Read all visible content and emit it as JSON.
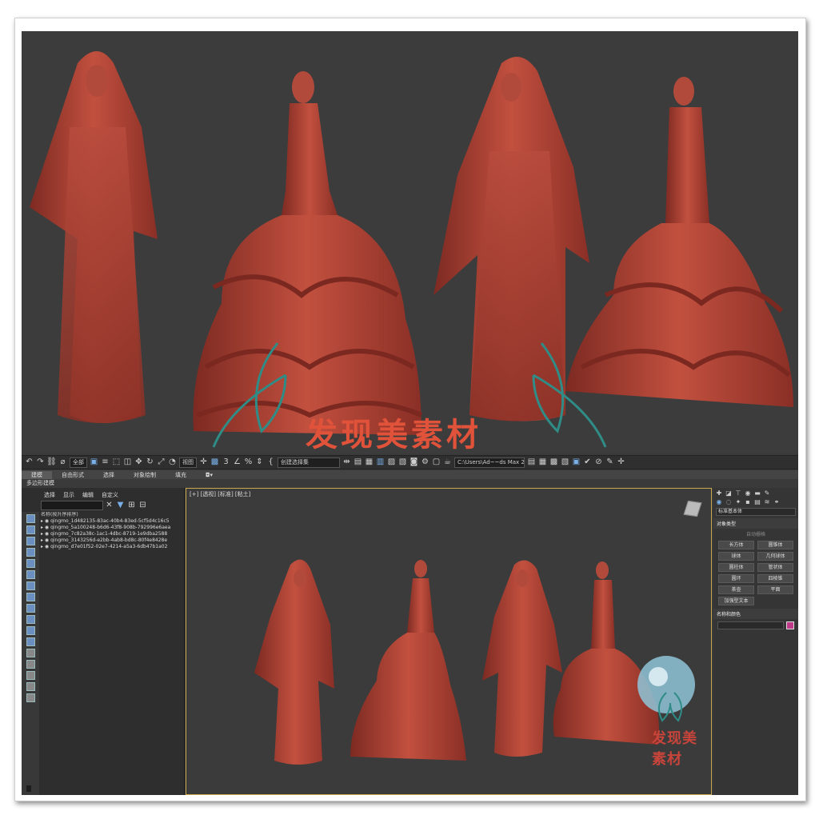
{
  "watermark": {
    "main_text": "发现美素材",
    "small_text": "发现美素材"
  },
  "toolbar": {
    "selection_filter": "全部",
    "view_dropdown": "视图",
    "selection_set": "创建选择集",
    "path_field": "C:\\Users\\Ad~~ds Max 2024"
  },
  "ribbon": {
    "tabs": [
      "建模",
      "自由形式",
      "选择",
      "对象绘制",
      "填充"
    ],
    "sub_label": "多边形建模"
  },
  "explorer": {
    "menu": [
      "选择",
      "显示",
      "编辑",
      "自定义"
    ],
    "header": "名称(按升序排序)",
    "rows": [
      "qingmo_1d482135-83ac-40b4-83ed-5cf5d4c16c5",
      "qingmo_5a100248-b6d6-43f8-908b-792996e6aea",
      "qingmo_7c82a38c-1ac1-4dbc-8719-1e9dba2588",
      "qingmo_3143256d-e2bb-4ab8-bd8c-80f4e8428e",
      "qingmo_d7e01f52-02e7-4214-a5a3-6db47b1a02"
    ]
  },
  "viewport": {
    "label": "[+] [透视] [标准] [粘土]"
  },
  "command_panel": {
    "category": "标准基本体",
    "rollout_object_type": "对象类型",
    "autogrid": "自动栅格",
    "buttons": [
      "长方体",
      "圆锥体",
      "球体",
      "几何球体",
      "圆柱体",
      "管状体",
      "圆环",
      "四棱锥",
      "茶壶",
      "平面",
      "加强型文本"
    ],
    "rollout_name_color": "名称和颜色"
  },
  "colors": {
    "clay": "#b0463c",
    "watermark": "#e0533a",
    "teal_butterfly": "#2f8c86",
    "object_color_swatch": "#c03a8a"
  }
}
